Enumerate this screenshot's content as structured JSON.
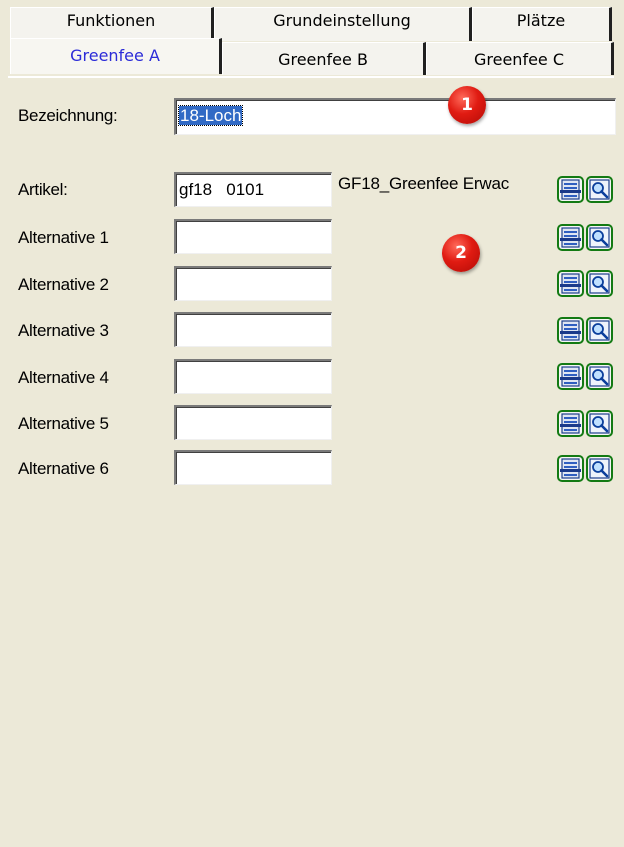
{
  "tabs": {
    "back_row": [
      {
        "label": "Funktionen"
      },
      {
        "label": "Grundeinstellung"
      },
      {
        "label": "Plätze"
      }
    ],
    "front_row": [
      {
        "label": "Greenfee A",
        "active": true
      },
      {
        "label": "Greenfee B",
        "active": false
      },
      {
        "label": "Greenfee C",
        "active": false
      }
    ]
  },
  "form": {
    "bezeichnung": {
      "label": "Bezeichnung:",
      "value": "18-Loch"
    },
    "artikel": {
      "label": "Artikel:",
      "value": "gf18   0101",
      "description": "GF18_Greenfee Erwac"
    },
    "alternatives": [
      {
        "label": "Alternative 1",
        "value": ""
      },
      {
        "label": "Alternative 2",
        "value": ""
      },
      {
        "label": "Alternative 3",
        "value": ""
      },
      {
        "label": "Alternative 4",
        "value": ""
      },
      {
        "label": "Alternative 5",
        "value": ""
      },
      {
        "label": "Alternative 6",
        "value": ""
      }
    ]
  },
  "icons": {
    "list": "list-icon",
    "search": "magnifier-icon"
  },
  "markers": [
    {
      "label": "1"
    },
    {
      "label": "2"
    }
  ],
  "colors": {
    "active_tab_text": "#2b2bd8",
    "selection": "#316ac5",
    "marker": "#e01b12",
    "icon_border": "#137a13"
  }
}
